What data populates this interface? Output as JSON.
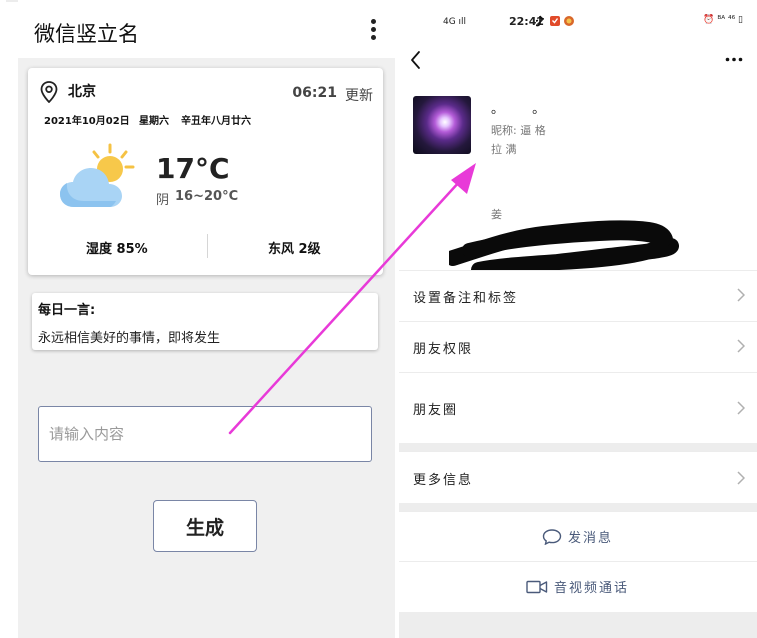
{
  "left_app": {
    "title": "微信竖立名",
    "weather": {
      "city": "北京",
      "time": "06:21",
      "update_label": "更新",
      "date": "2021年10月02日",
      "weekday": "星期六",
      "lunar_date": "辛丑年八月廿六",
      "temperature": "17°C",
      "condition": "阴",
      "temp_range": "16~20°C",
      "humidity": "湿度 85%",
      "wind": "东风 2级",
      "icon": "partly-cloudy-icon"
    },
    "quote": {
      "title": "每日一言:",
      "text": "永远相信美好的事情，即将发生"
    },
    "input_placeholder": "请输入内容",
    "generate_label": "生成"
  },
  "right_app": {
    "status_bar": {
      "network": "4G ıll",
      "time": "22:42",
      "right_icons": "⏰ ᴮᴬ ⁴⁶ ▯"
    },
    "profile": {
      "name": "。 。",
      "nickname_label": "昵称:",
      "nickname_chars": "逼 格 拉 满",
      "extra_char": "姜"
    },
    "menu_rows": [
      {
        "label": "设置备注和标签"
      },
      {
        "label": "朋友权限"
      },
      {
        "label": "朋友圈"
      },
      {
        "label": "更多信息"
      }
    ],
    "actions": [
      {
        "label": "发消息",
        "icon": "chat-bubble-icon"
      },
      {
        "label": "音视频通话",
        "icon": "video-call-icon"
      }
    ]
  },
  "colors": {
    "arrow": "#e83ad8",
    "action_text": "#4a5a7a",
    "border": "#7a86a6"
  }
}
